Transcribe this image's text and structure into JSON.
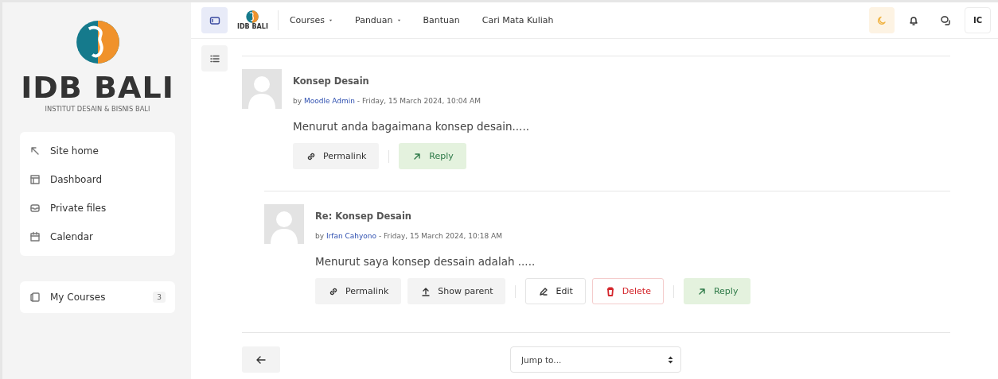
{
  "sidebar": {
    "logo": {
      "name": "IDB BALI",
      "tagline": "INSTITUT DESAIN & BISNIS BALI"
    },
    "nav": [
      {
        "label": "Site home"
      },
      {
        "label": "Dashboard"
      },
      {
        "label": "Private files"
      },
      {
        "label": "Calendar"
      }
    ],
    "my_courses": {
      "label": "My Courses",
      "count": "3"
    }
  },
  "topbar": {
    "logo": "IDB BALI",
    "menu": [
      {
        "label": "Courses",
        "dropdown": true
      },
      {
        "label": "Panduan",
        "dropdown": true
      },
      {
        "label": "Bantuan",
        "dropdown": false
      },
      {
        "label": "Cari Mata Kuliah",
        "dropdown": false
      }
    ],
    "user_initials": "IC"
  },
  "posts": [
    {
      "title": "Konsep Desain",
      "prefix": "by",
      "author": "Moodle Admin",
      "date": "- Friday, 15 March 2024, 10:04 AM",
      "message": "Menurut anda bagaimana konsep desain.....",
      "actions": [
        {
          "kind": "permalink",
          "label": "Permalink"
        },
        {
          "kind": "separator"
        },
        {
          "kind": "reply",
          "label": "Reply"
        }
      ],
      "children": [
        {
          "title": "Re: Konsep Desain",
          "prefix": "by",
          "author": "Irfan Cahyono",
          "date": "- Friday, 15 March 2024, 10:18 AM",
          "message": "Menurut saya konsep dessain adalah .....",
          "actions": [
            {
              "kind": "permalink",
              "label": "Permalink"
            },
            {
              "kind": "parent",
              "label": "Show parent"
            },
            {
              "kind": "separator"
            },
            {
              "kind": "edit",
              "label": "Edit"
            },
            {
              "kind": "delete",
              "label": "Delete"
            },
            {
              "kind": "separator"
            },
            {
              "kind": "reply",
              "label": "Reply"
            }
          ]
        }
      ]
    }
  ],
  "footer": {
    "jump": {
      "placeholder": "Jump to..."
    }
  }
}
